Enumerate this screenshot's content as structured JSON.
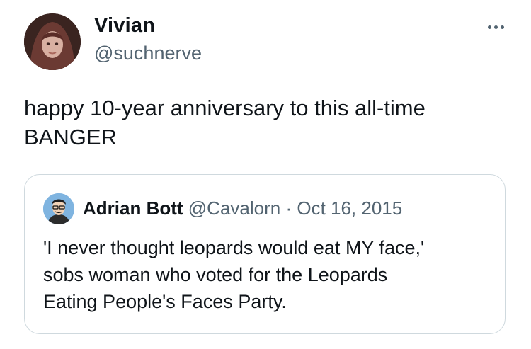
{
  "tweet": {
    "author_name": "Vivian",
    "author_handle": "@suchnerve",
    "text": "happy 10-year anniversary to this all-time\nBANGER"
  },
  "quoted_tweet": {
    "author_name": "Adrian Bott",
    "author_handle": "@Cavalorn",
    "separator": " · ",
    "date": "Oct 16, 2015",
    "text": "'I never thought leopards would eat MY face,'\nsobs woman who voted for the Leopards\nEating People's Faces Party."
  },
  "icons": {
    "more": "more-horizontal-icon"
  },
  "colors": {
    "text": "#0f1419",
    "secondary": "#536471",
    "border": "#cfd9de"
  }
}
